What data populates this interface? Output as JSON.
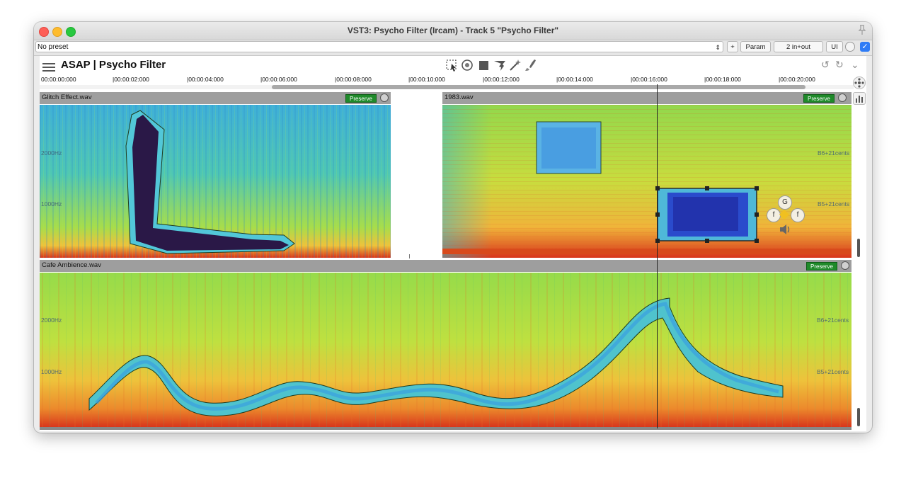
{
  "window": {
    "title": "VST3: Psycho Filter (Ircam) - Track 5 \"Psycho Filter\"",
    "traffic_lights": [
      "close",
      "minimize",
      "zoom"
    ],
    "pin_icon": "pin-icon"
  },
  "host_bar": {
    "preset_value": "No preset",
    "plus_label": "+",
    "param_label": "Param",
    "io_label": "2 in+out",
    "ui_label": "UI",
    "enabled": true
  },
  "plugin": {
    "brand": "ASAP | Psycho Filter",
    "toolbar_icons": [
      "selection-tool-icon",
      "target-tool-icon",
      "square-tool-icon",
      "tornado-tool-icon",
      "magic-wand-icon",
      "brush-tool-icon"
    ],
    "right_icons": [
      "undo-icon",
      "redo-icon",
      "chevron-down-icon"
    ],
    "timeline": [
      "00:00:00:000",
      "|00:00:02:000",
      "|00:00:04:000",
      "|00:00:06:000",
      "|00:00:08:000",
      "|00:00:10:000",
      "|00:00:12:000",
      "|00:00:14:000",
      "|00:00:16:000",
      "|00:00:18:000",
      "|00:00:20:000"
    ],
    "playhead_time": "00:00:16:000"
  },
  "tracks": [
    {
      "name": "Glitch Effect.wav",
      "preserve_label": "Preserve",
      "freq_labels_left": [
        "2000Hz",
        "1000Hz"
      ],
      "note_labels_right": []
    },
    {
      "name": "1983.wav",
      "preserve_label": "Preserve",
      "freq_labels_left": [],
      "note_labels_right": [
        "B6+21cents",
        "B5+21cents"
      ]
    },
    {
      "name": "Cafe Ambience.wav",
      "preserve_label": "Preserve",
      "freq_labels_left": [
        "2000Hz",
        "1000Hz"
      ],
      "note_labels_right": [
        "B6+21cents",
        "B5+21cents"
      ]
    }
  ],
  "selection_controls": {
    "center_label": "G",
    "side_labels": [
      "f",
      "f"
    ],
    "speaker_icon": "speaker-icon"
  },
  "colors": {
    "accent": "#2f7cf6",
    "preserve_green": "#1f8a2a",
    "spectrogram_green": "#9ee04a",
    "spectrogram_red": "#e04a1f",
    "filter_dark": "#2a1847"
  }
}
